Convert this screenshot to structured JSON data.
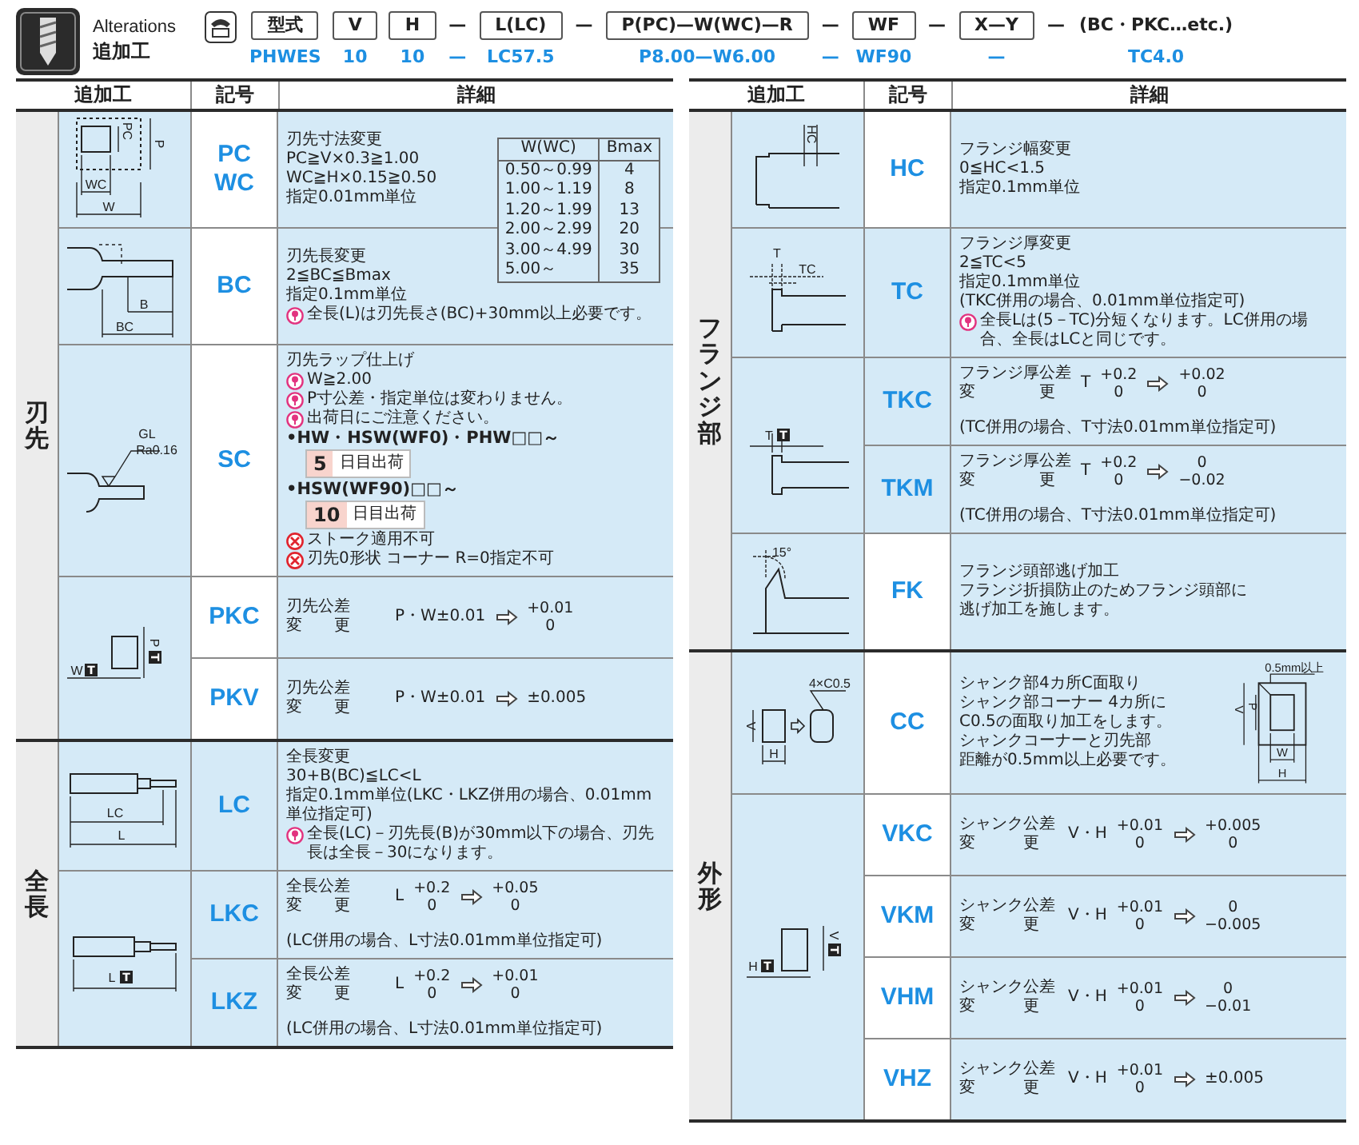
{
  "header": {
    "title_en": "Alterations",
    "title_ja": "追加工",
    "code_columns": [
      {
        "kind": "box",
        "label": "型式",
        "value": "PHWES"
      },
      {
        "kind": "box",
        "label": "V",
        "value": "10"
      },
      {
        "kind": "box",
        "label": "H",
        "value": "10"
      },
      {
        "kind": "sep",
        "label": "—",
        "value": "—"
      },
      {
        "kind": "box",
        "label": "L(LC)",
        "value": "LC57.5"
      },
      {
        "kind": "sep",
        "label": "—"
      },
      {
        "kind": "box",
        "label": "P(PC)—W(WC)—R",
        "value": "P8.00—W6.00"
      },
      {
        "kind": "sep",
        "label": "—",
        "value": "—"
      },
      {
        "kind": "box",
        "label": "WF",
        "value": "WF90"
      },
      {
        "kind": "sep",
        "label": "—"
      },
      {
        "kind": "box",
        "label": "X—Y",
        "value": "—"
      },
      {
        "kind": "sep",
        "label": "—"
      },
      {
        "kind": "plain",
        "label": "(BC・PKC…etc.)",
        "value": "TC4.0"
      }
    ]
  },
  "panels": [
    {
      "columns": [
        "追加工",
        "記号",
        "詳細"
      ],
      "groups": [
        {
          "category": "刃先",
          "blocks": [
            {
              "figure": {
                "kind": "tip-section",
                "labels": [
                  {
                    "text": "PC"
                  },
                  {
                    "text": "P"
                  },
                  {
                    "text": "WC"
                  },
                  {
                    "text": "W"
                  }
                ]
              },
              "rows": [
                {
                  "codes": [
                    "PC",
                    "WC"
                  ],
                  "shaded": false,
                  "details": [
                    {
                      "kind": "text",
                      "text": "刃先寸法変更"
                    },
                    {
                      "kind": "text",
                      "text": "PC≧V×0.3≧1.00"
                    },
                    {
                      "kind": "text",
                      "text": "WC≧H×0.15≧0.50"
                    },
                    {
                      "kind": "text",
                      "text": "指定0.01mm単位"
                    },
                    {
                      "kind": "table",
                      "columns": [
                        "W(WC)",
                        "Bmax"
                      ],
                      "rows": [
                        [
                          "0.50～0.99",
                          "4"
                        ],
                        [
                          "1.00～1.19",
                          "8"
                        ],
                        [
                          "1.20～1.99",
                          "13"
                        ],
                        [
                          "2.00～2.99",
                          "20"
                        ],
                        [
                          "3.00～4.99",
                          "30"
                        ],
                        [
                          "5.00～",
                          "35"
                        ]
                      ]
                    }
                  ]
                }
              ]
            },
            {
              "figure": {
                "kind": "tip-length",
                "labels": [
                  {
                    "text": "B"
                  },
                  {
                    "text": "BC"
                  }
                ]
              },
              "rows": [
                {
                  "codes": [
                    "BC"
                  ],
                  "shaded": false,
                  "details": [
                    {
                      "kind": "text",
                      "text": "刃先長変更"
                    },
                    {
                      "kind": "text",
                      "text": "2≦BC≦Bmax"
                    },
                    {
                      "kind": "text",
                      "text": "指定0.1mm単位"
                    },
                    {
                      "kind": "note",
                      "text": "全長(L)は刃先長さ(BC)+30mm以上必要です。"
                    }
                  ]
                }
              ]
            },
            {
              "figure": {
                "kind": "lap",
                "labels": [
                  {
                    "text": "GL"
                  },
                  {
                    "text": "Ra0.16"
                  }
                ]
              },
              "rows": [
                {
                  "codes": [
                    "SC"
                  ],
                  "shaded": false,
                  "details": [
                    {
                      "kind": "text",
                      "text": "刃先ラップ仕上げ"
                    },
                    {
                      "kind": "note",
                      "text": "W≧2.00"
                    },
                    {
                      "kind": "note",
                      "text": "P寸公差・指定単位は変わりません。"
                    },
                    {
                      "kind": "note",
                      "text": "出荷日にご注意ください。"
                    },
                    {
                      "kind": "bullet",
                      "text": "•HW・HSW(WF0)・PHW□□～"
                    },
                    {
                      "kind": "badge",
                      "number": "5",
                      "text": "日目出荷"
                    },
                    {
                      "kind": "bullet",
                      "text": "•HSW(WF90)□□～"
                    },
                    {
                      "kind": "badge",
                      "number": "10",
                      "text": "日目出荷"
                    },
                    {
                      "kind": "ban",
                      "text": "ストーク適用不可"
                    },
                    {
                      "kind": "ban",
                      "text": "刃先0形状 コーナー R=0指定不可"
                    }
                  ]
                }
              ]
            },
            {
              "figure": {
                "kind": "tip-tolerance",
                "labels": [
                  {
                    "text": "W",
                    "mark": "T"
                  },
                  {
                    "text": "P",
                    "mark": "T"
                  }
                ]
              },
              "rows": [
                {
                  "codes": [
                    "PKC"
                  ],
                  "shaded": false,
                  "details": [
                    {
                      "kind": "tolerance",
                      "title": "刃先公差",
                      "title2": "変　　更",
                      "symbol": "P・W±0.01",
                      "to": {
                        "upper": "+0.01",
                        "lower": "0"
                      }
                    }
                  ]
                },
                {
                  "codes": [
                    "PKV"
                  ],
                  "shaded": false,
                  "details": [
                    {
                      "kind": "tolerance",
                      "title": "刃先公差",
                      "title2": "変　　更",
                      "symbol": "P・W±0.01",
                      "to": {
                        "text": "±0.005"
                      }
                    }
                  ]
                }
              ]
            }
          ]
        },
        {
          "category": "全長",
          "blocks": [
            {
              "figure": {
                "kind": "length",
                "labels": [
                  {
                    "text": "LC"
                  },
                  {
                    "text": "L"
                  }
                ]
              },
              "rows": [
                {
                  "codes": [
                    "LC"
                  ],
                  "shaded": true,
                  "details": [
                    {
                      "kind": "text",
                      "text": "全長変更"
                    },
                    {
                      "kind": "text",
                      "text": "30+B(BC)≦LC<L"
                    },
                    {
                      "kind": "text",
                      "text": "指定0.1mm単位(LKC・LKZ併用の場合、0.01mm単位指定可)"
                    },
                    {
                      "kind": "note",
                      "text": "全長(LC)－刃先長(B)が30mm以下の場合、刃先長は全長－30になります。"
                    }
                  ]
                }
              ]
            },
            {
              "figure": {
                "kind": "length-tolerance",
                "labels": [
                  {
                    "text": "L",
                    "mark": "T"
                  }
                ]
              },
              "rows": [
                {
                  "codes": [
                    "LKC"
                  ],
                  "shaded": true,
                  "details": [
                    {
                      "kind": "tolerance",
                      "title": "全長公差",
                      "title2": "変　　更",
                      "symbol": "L",
                      "from": {
                        "upper": "+0.2",
                        "lower": "0"
                      },
                      "to": {
                        "upper": "+0.05",
                        "lower": "0"
                      }
                    },
                    {
                      "kind": "text",
                      "text": "(LC併用の場合、L寸法0.01mm単位指定可)"
                    }
                  ]
                },
                {
                  "codes": [
                    "LKZ"
                  ],
                  "shaded": true,
                  "details": [
                    {
                      "kind": "tolerance",
                      "title": "全長公差",
                      "title2": "変　　更",
                      "symbol": "L",
                      "from": {
                        "upper": "+0.2",
                        "lower": "0"
                      },
                      "to": {
                        "upper": "+0.01",
                        "lower": "0"
                      }
                    },
                    {
                      "kind": "text",
                      "text": "(LC併用の場合、L寸法0.01mm単位指定可)"
                    }
                  ]
                }
              ]
            }
          ]
        }
      ]
    },
    {
      "columns": [
        "追加工",
        "記号",
        "詳細"
      ],
      "groups": [
        {
          "category": "フランジ部",
          "blocks": [
            {
              "figure": {
                "kind": "flange-width",
                "labels": [
                  {
                    "text": "HC"
                  }
                ]
              },
              "rows": [
                {
                  "codes": [
                    "HC"
                  ],
                  "shaded": false,
                  "details": [
                    {
                      "kind": "text",
                      "text": "フランジ幅変更"
                    },
                    {
                      "kind": "text",
                      "text": "0≦HC<1.5"
                    },
                    {
                      "kind": "text",
                      "text": "指定0.1mm単位"
                    }
                  ]
                }
              ]
            },
            {
              "figure": {
                "kind": "flange-thickness",
                "labels": [
                  {
                    "text": "T"
                  },
                  {
                    "text": "TC"
                  }
                ]
              },
              "rows": [
                {
                  "codes": [
                    "TC"
                  ],
                  "shaded": true,
                  "details": [
                    {
                      "kind": "text",
                      "text": "フランジ厚変更"
                    },
                    {
                      "kind": "text",
                      "text": "2≦TC<5"
                    },
                    {
                      "kind": "text",
                      "text": "指定0.1mm単位"
                    },
                    {
                      "kind": "text",
                      "text": "(TKC併用の場合、0.01mm単位指定可)"
                    },
                    {
                      "kind": "note",
                      "text": "全長Lは(5－TC)分短くなります。LC併用の場合、全長はLCと同じです。"
                    }
                  ]
                }
              ]
            },
            {
              "figure": {
                "kind": "flange-tolerance",
                "labels": [
                  {
                    "text": "T",
                    "mark": "T"
                  }
                ]
              },
              "rows": [
                {
                  "codes": [
                    "TKC"
                  ],
                  "shaded": true,
                  "details": [
                    {
                      "kind": "tolerance",
                      "title": "フランジ厚公差",
                      "title2": "変　　　　更",
                      "symbol": "T",
                      "from": {
                        "upper": "+0.2",
                        "lower": "0"
                      },
                      "to": {
                        "upper": "+0.02",
                        "lower": "0"
                      }
                    },
                    {
                      "kind": "text",
                      "text": "(TC併用の場合、T寸法0.01mm単位指定可)"
                    }
                  ]
                },
                {
                  "codes": [
                    "TKM"
                  ],
                  "shaded": true,
                  "details": [
                    {
                      "kind": "tolerance",
                      "title": "フランジ厚公差",
                      "title2": "変　　　　更",
                      "symbol": "T",
                      "from": {
                        "upper": "+0.2",
                        "lower": "0"
                      },
                      "to": {
                        "upper": "0",
                        "lower": "−0.02"
                      }
                    },
                    {
                      "kind": "text",
                      "text": "(TC併用の場合、T寸法0.01mm単位指定可)"
                    }
                  ]
                }
              ]
            },
            {
              "figure": {
                "kind": "flange-relief",
                "labels": [
                  {
                    "text": "15°"
                  }
                ]
              },
              "rows": [
                {
                  "codes": [
                    "FK"
                  ],
                  "shaded": false,
                  "details": [
                    {
                      "kind": "text",
                      "text": "フランジ頭部逃げ加工"
                    },
                    {
                      "kind": "text",
                      "text": "フランジ折損防止のためフランジ頭部に"
                    },
                    {
                      "kind": "text",
                      "text": "逃げ加工を施します。"
                    }
                  ]
                }
              ]
            }
          ]
        },
        {
          "category": "外形",
          "blocks": [
            {
              "figure": {
                "kind": "chamfer",
                "labels": [
                  {
                    "text": "4×C0.5"
                  },
                  {
                    "text": "V"
                  },
                  {
                    "text": "H"
                  }
                ]
              },
              "rows": [
                {
                  "codes": [
                    "CC"
                  ],
                  "shaded": false,
                  "details": [
                    {
                      "kind": "text",
                      "text": "シャンク部4カ所C面取り"
                    },
                    {
                      "kind": "text",
                      "text": "シャンク部コーナー 4カ所に"
                    },
                    {
                      "kind": "text",
                      "text": "C0.5の面取り加工をします。"
                    },
                    {
                      "kind": "text",
                      "text": "シャンクコーナーと刃先部"
                    },
                    {
                      "kind": "text",
                      "text": "距離が0.5mm以上必要です。"
                    }
                  ],
                  "diagram": {
                    "kind": "corner-distance",
                    "labels": [
                      {
                        "text": "0.5mm以上"
                      },
                      {
                        "text": "V"
                      },
                      {
                        "text": "P"
                      },
                      {
                        "text": "W"
                      },
                      {
                        "text": "H"
                      }
                    ]
                  }
                }
              ]
            },
            {
              "figure": {
                "kind": "shank-tolerance",
                "labels": [
                  {
                    "text": "H",
                    "mark": "T"
                  },
                  {
                    "text": "V",
                    "mark": "T"
                  }
                ]
              },
              "rows": [
                {
                  "codes": [
                    "VKC"
                  ],
                  "shaded": false,
                  "details": [
                    {
                      "kind": "tolerance",
                      "title": "シャンク公差",
                      "title2": "変　　　更",
                      "symbol": "V・H",
                      "from": {
                        "upper": "+0.01",
                        "lower": "0"
                      },
                      "to": {
                        "upper": "+0.005",
                        "lower": "0"
                      }
                    }
                  ]
                },
                {
                  "codes": [
                    "VKM"
                  ],
                  "shaded": false,
                  "details": [
                    {
                      "kind": "tolerance",
                      "title": "シャンク公差",
                      "title2": "変　　　更",
                      "symbol": "V・H",
                      "from": {
                        "upper": "+0.01",
                        "lower": "0"
                      },
                      "to": {
                        "upper": "0",
                        "lower": "−0.005"
                      }
                    }
                  ]
                },
                {
                  "codes": [
                    "VHM"
                  ],
                  "shaded": false,
                  "details": [
                    {
                      "kind": "tolerance",
                      "title": "シャンク公差",
                      "title2": "変　　　更",
                      "symbol": "V・H",
                      "from": {
                        "upper": "+0.01",
                        "lower": "0"
                      },
                      "to": {
                        "upper": "0",
                        "lower": "−0.01"
                      }
                    }
                  ]
                },
                {
                  "codes": [
                    "VHZ"
                  ],
                  "shaded": false,
                  "details": [
                    {
                      "kind": "tolerance",
                      "title": "シャンク公差",
                      "title2": "変　　　更",
                      "symbol": "V・H",
                      "from": {
                        "upper": "+0.01",
                        "lower": "0"
                      },
                      "to": {
                        "text": "±0.005"
                      }
                    }
                  ]
                }
              ]
            }
          ]
        }
      ]
    }
  ]
}
